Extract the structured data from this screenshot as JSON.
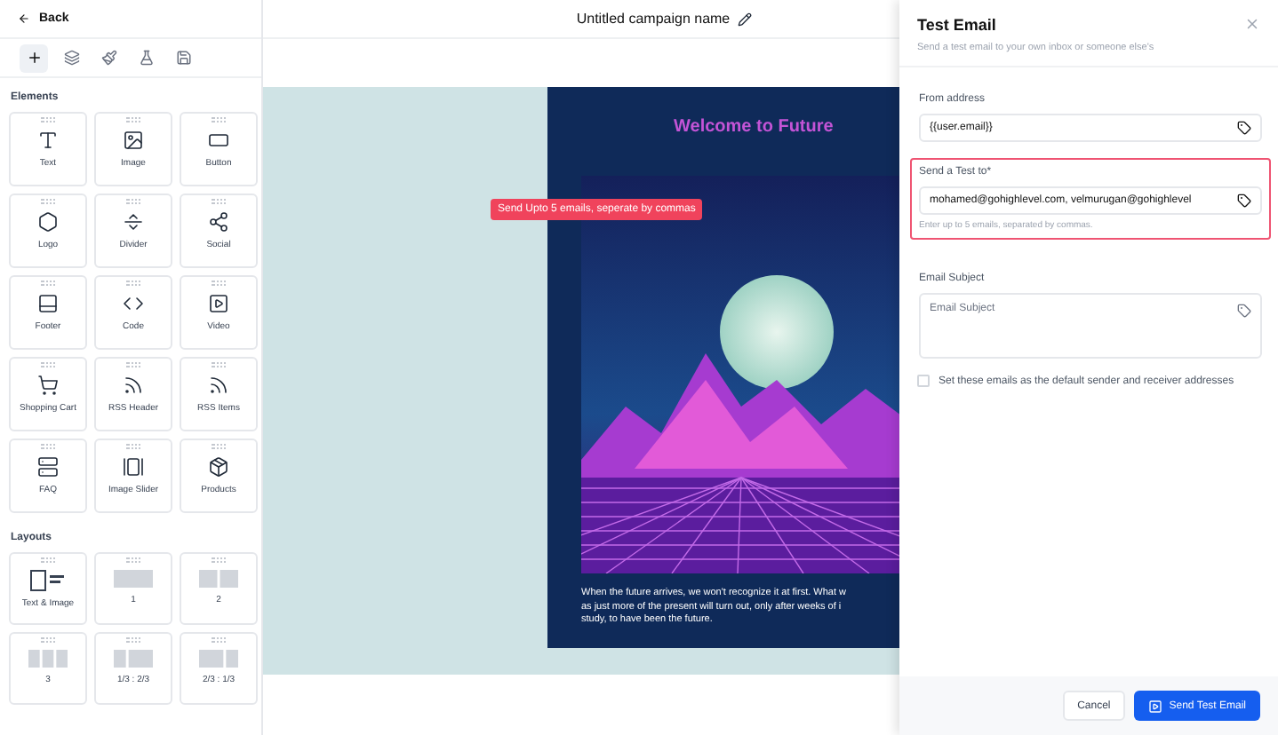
{
  "header": {
    "back": "Back",
    "title": "Untitled campaign name"
  },
  "toolbar": [
    {
      "selected": true
    },
    {
      "selected": false
    },
    {
      "selected": false
    },
    {
      "selected": false
    },
    {
      "selected": false
    }
  ],
  "elements": {
    "heading": "Elements",
    "items": [
      {
        "label": "Text"
      },
      {
        "label": "Image"
      },
      {
        "label": "Button"
      },
      {
        "label": "Logo"
      },
      {
        "label": "Divider"
      },
      {
        "label": "Social"
      },
      {
        "label": "Footer"
      },
      {
        "label": "Code"
      },
      {
        "label": "Video"
      },
      {
        "label": "Shopping Cart"
      },
      {
        "label": "RSS Header"
      },
      {
        "label": "RSS Items"
      },
      {
        "label": "FAQ"
      },
      {
        "label": "Image Slider"
      },
      {
        "label": "Products"
      }
    ]
  },
  "layouts": {
    "heading": "Layouts",
    "items": [
      {
        "label": "Text & Image",
        "kind": "textimage"
      },
      {
        "label": "1",
        "kind": "columns"
      },
      {
        "label": "2",
        "kind": "columns"
      },
      {
        "label": "3",
        "kind": "columns"
      },
      {
        "label": "1/3 : 2/3",
        "kind": "columns"
      },
      {
        "label": "2/3 : 1/3",
        "kind": "columns"
      }
    ]
  },
  "preview": {
    "heading": "Welcome to Future",
    "lines": [
      "When the future arrives, we won't recognize it at first. What w",
      "as just more of the present will turn out, only after weeks of i",
      "study, to have been the future."
    ]
  },
  "tooltip": "Send Upto 5 emails, seperate by commas",
  "panel": {
    "title": "Test Email",
    "subtitle": "Send a test email to your own inbox or someone else's",
    "fields": [
      {
        "label": "From address",
        "kind": "input",
        "value": "{{user.email}}",
        "highlighted": false
      },
      {
        "label": "Send a Test to*",
        "kind": "input",
        "value": "mohamed@gohighlevel.com, velmurugan@gohighlevel",
        "help": "Enter up to 5 emails, separated by commas.",
        "highlighted": true
      },
      {
        "label": "Email Subject",
        "kind": "textarea",
        "placeholder": "Email Subject",
        "highlighted": false
      }
    ],
    "checkbox": {
      "label": "Set these emails as the default sender and receiver addresses",
      "checked": false
    },
    "cancel": "Cancel",
    "send": "Send Test Email"
  }
}
